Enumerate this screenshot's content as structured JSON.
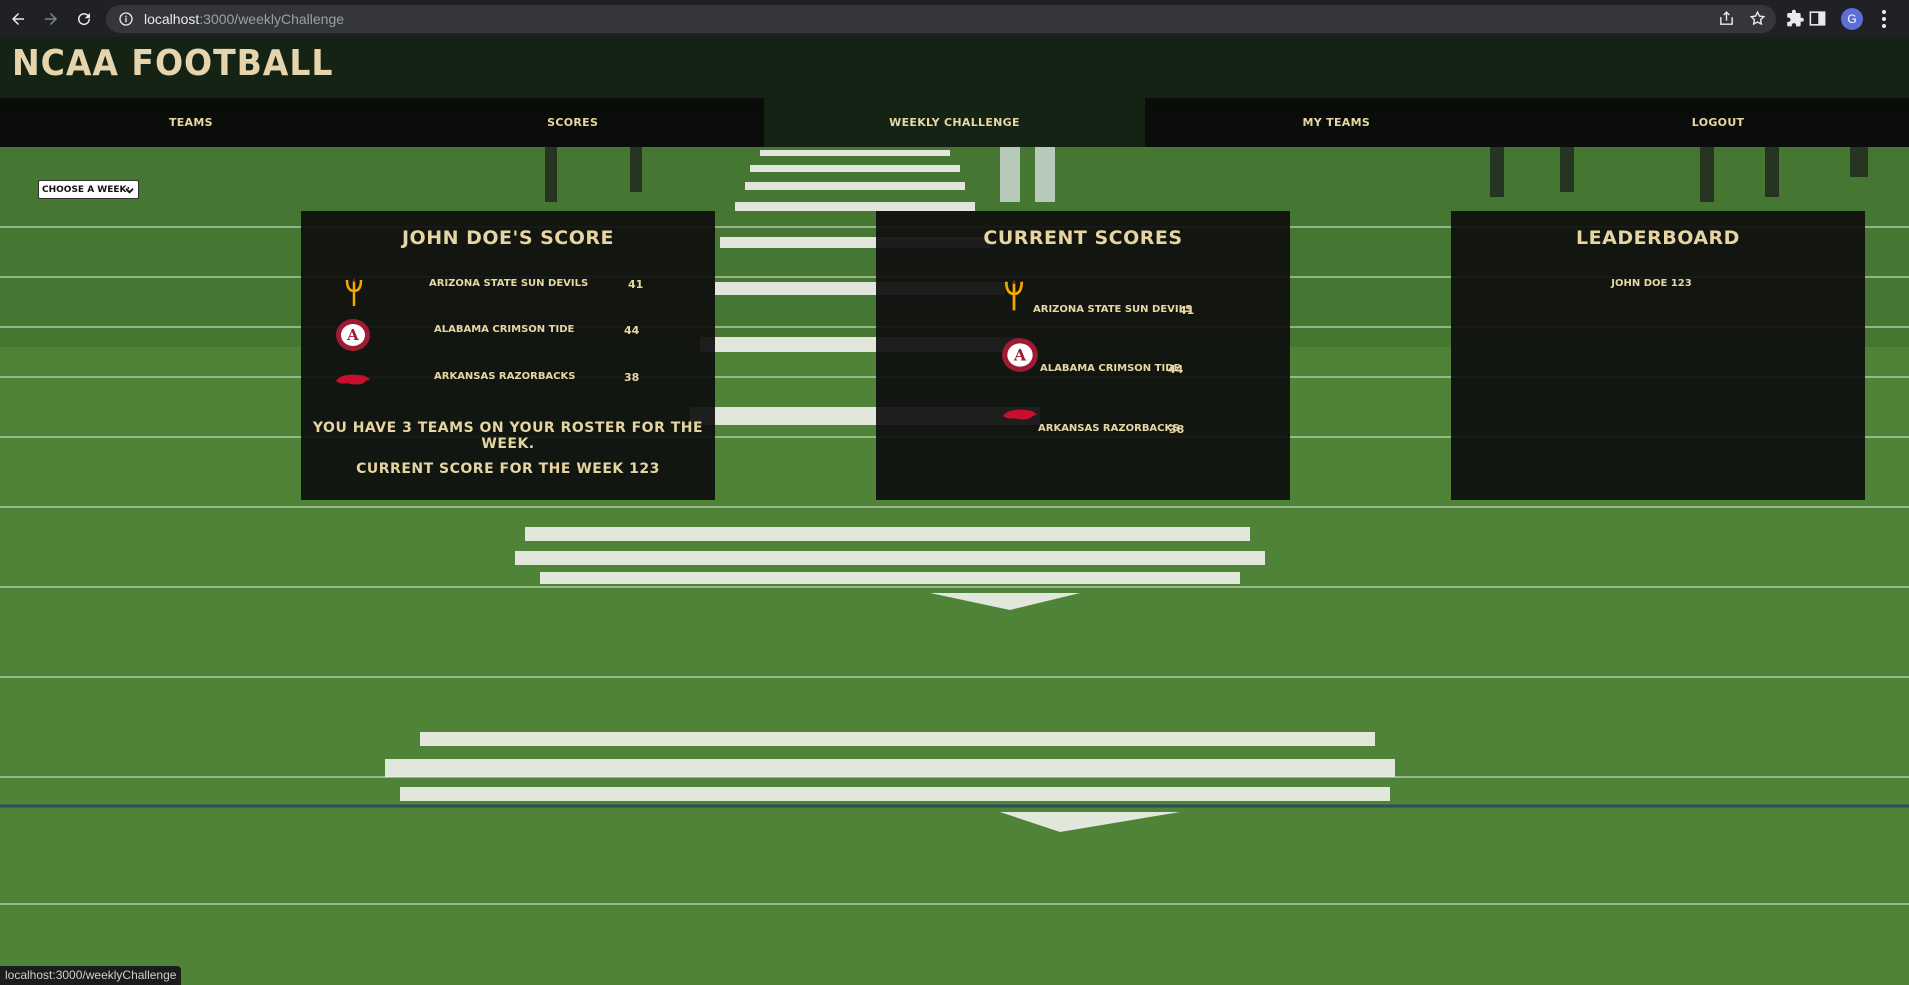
{
  "browser": {
    "url_host": "localhost",
    "url_path": ":3000/weeklyChallenge",
    "profile_initial": "G",
    "status_link": "localhost:3000/weeklyChallenge"
  },
  "site": {
    "title": "NCAA FOOTBALL"
  },
  "nav": {
    "items": [
      {
        "label": "TEAMS"
      },
      {
        "label": "SCORES"
      },
      {
        "label": "WEEKLY CHALLENGE"
      },
      {
        "label": "MY TEAMS"
      },
      {
        "label": "LOGOUT"
      }
    ]
  },
  "week_select": {
    "value": "CHOOSE A WEEK:"
  },
  "user_panel": {
    "title": "JOHN DOE'S SCORE",
    "rows": [
      {
        "team": "ARIZONA STATE SUN DEVILS",
        "score": "41",
        "icon": "pitchfork-icon"
      },
      {
        "team": "ALABAMA CRIMSON TIDE",
        "score": "44",
        "icon": "alabama-logo"
      },
      {
        "team": "ARKANSAS RAZORBACKS",
        "score": "38",
        "icon": "razorback-logo"
      }
    ],
    "roster_text": "YOU HAVE 3 TEAMS ON YOUR ROSTER FOR THE WEEK.",
    "week_score_text": "CURRENT SCORE FOR THE WEEK 123"
  },
  "current_panel": {
    "title": "CURRENT SCORES",
    "rows": [
      {
        "team": "ARIZONA STATE SUN DEVILS",
        "score": "41"
      },
      {
        "team": "ALABAMA CRIMSON TIDE",
        "score": "44"
      },
      {
        "team": "ARKANSAS RAZORBACKS",
        "score": "38"
      }
    ]
  },
  "leaderboard_panel": {
    "title": "LEADERBOARD",
    "entries": [
      {
        "text": "JOHN DOE 123"
      }
    ]
  },
  "colors": {
    "header_bg": "#142314",
    "nav_bg": "#080808",
    "text_gold": "#e6d4a2",
    "asu_maroon": "#8c1d40",
    "asu_gold": "#f2a900",
    "alabama_crimson": "#9e1b32",
    "arkansas_red": "#c8102e"
  }
}
